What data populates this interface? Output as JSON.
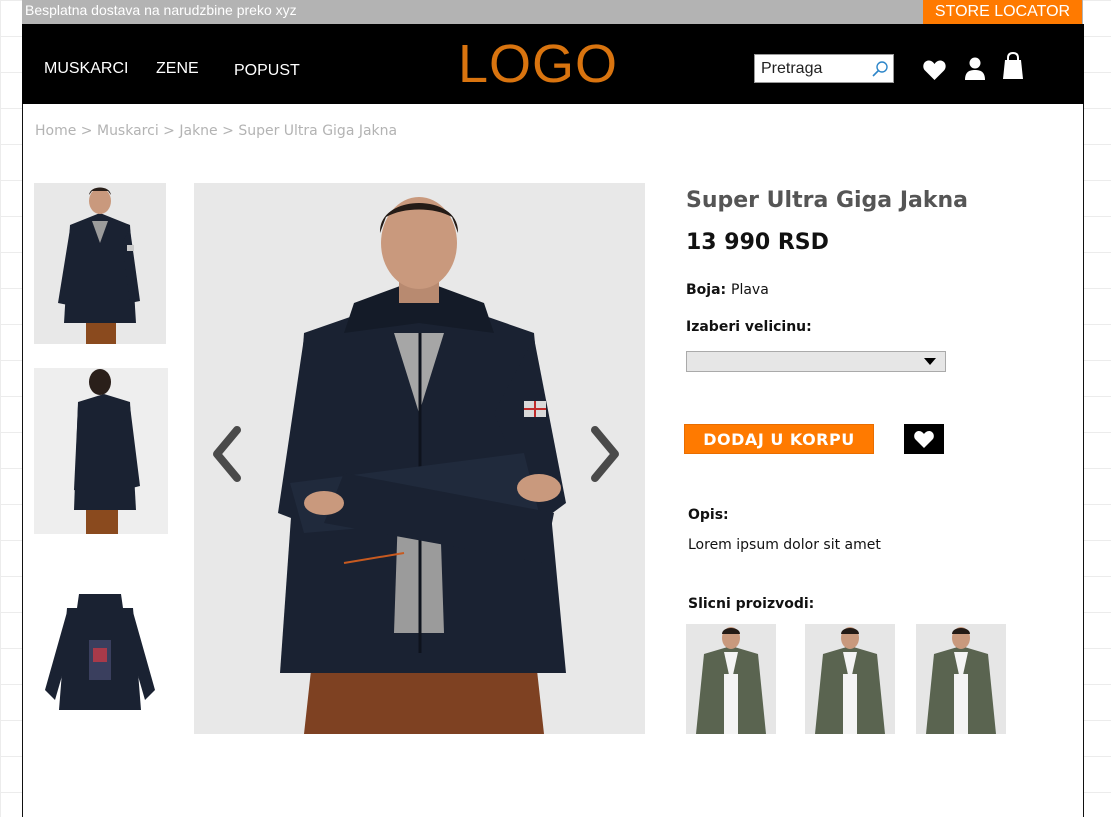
{
  "topbar": {
    "promo": "Besplatna dostava na narudzbine preko xyz",
    "store_locator": "STORE LOCATOR"
  },
  "nav": {
    "men": "MUSKARCI",
    "women": "ZENE",
    "sale": "POPUST"
  },
  "logo": "LOGO",
  "search": {
    "value": "Pretraga"
  },
  "breadcrumb": [
    "Home",
    "Muskarci",
    "Jakne",
    "Super Ultra Giga Jakna"
  ],
  "breadcrumb_sep": ">",
  "product": {
    "title": "Super Ultra Giga Jakna",
    "price": "13 990 RSD",
    "color_label": "Boja:",
    "color_value": "Plava",
    "size_label": "Izaberi velicinu:",
    "size_selected": "",
    "add_to_cart": "DODAJ U KORPU",
    "description_label": "Opis:",
    "description": "Lorem ipsum dolor sit amet",
    "similar_label": "Slicni proizvodi:"
  },
  "colors": {
    "accent": "#ff7a00",
    "logo": "#d9740f",
    "header_bg": "#000000",
    "topbar_bg": "#b3b3b3",
    "breadcrumb": "#b3b3b3"
  },
  "icons": [
    "search-icon",
    "heart-icon",
    "user-icon",
    "shopping-bag-icon",
    "chevron-left-icon",
    "chevron-right-icon",
    "chevron-down-icon"
  ]
}
